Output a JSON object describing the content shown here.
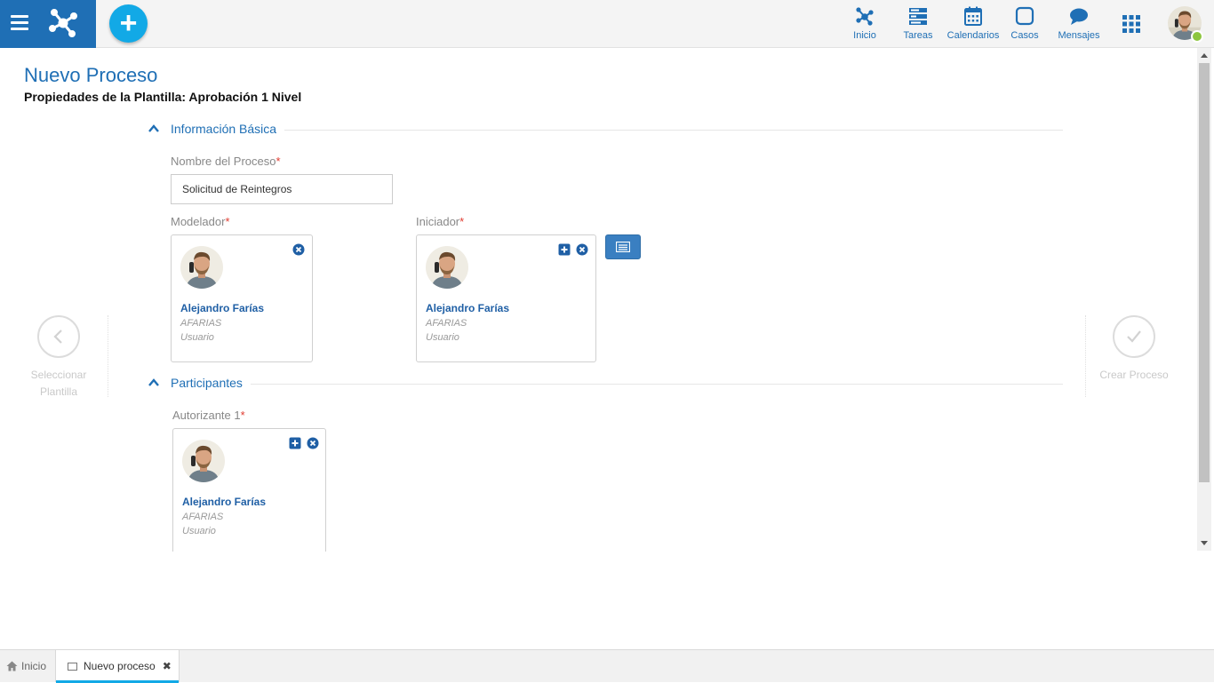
{
  "topbar": {
    "nav": [
      {
        "id": "inicio",
        "label": "Inicio",
        "icon": "process-network-icon"
      },
      {
        "id": "tareas",
        "label": "Tareas",
        "icon": "tasks-icon"
      },
      {
        "id": "calendarios",
        "label": "Calendarios",
        "icon": "calendar-icon"
      },
      {
        "id": "casos",
        "label": "Casos",
        "icon": "cases-icon"
      },
      {
        "id": "mensajes",
        "label": "Mensajes",
        "icon": "chat-bubble-icon"
      }
    ],
    "add_label": "+"
  },
  "page": {
    "title": "Nuevo Proceso",
    "subtitle": "Propiedades de la Plantilla: Aprobación 1 Nivel"
  },
  "steps": {
    "prev_label": "Seleccionar Plantilla",
    "next_label": "Crear Proceso"
  },
  "sections": {
    "basic": {
      "title": "Información Básica",
      "process_name_label": "Nombre del Proceso",
      "process_name_value": "Solicitud de Reintegros",
      "modeler_label": "Modelador",
      "initiator_label": "Iniciador"
    },
    "participants": {
      "title": "Participantes",
      "authorizer_label": "Autorizante 1"
    }
  },
  "required_mark": "*",
  "users": {
    "modeler": {
      "name": "Alejandro Farías",
      "login": "AFARIAS",
      "type": "Usuario"
    },
    "initiator": {
      "name": "Alejandro Farías",
      "login": "AFARIAS",
      "type": "Usuario"
    },
    "authorizer": {
      "name": "Alejandro Farías",
      "login": "AFARIAS",
      "type": "Usuario"
    }
  },
  "tabs": [
    {
      "label": "Inicio",
      "icon": "home-icon"
    },
    {
      "label": "Nuevo proceso",
      "icon": "window-icon",
      "close": "✖"
    }
  ],
  "colors": {
    "brand": "#1f6fb5",
    "accent": "#12a9e6",
    "required": "#e03c31",
    "online": "#8dc63f"
  }
}
